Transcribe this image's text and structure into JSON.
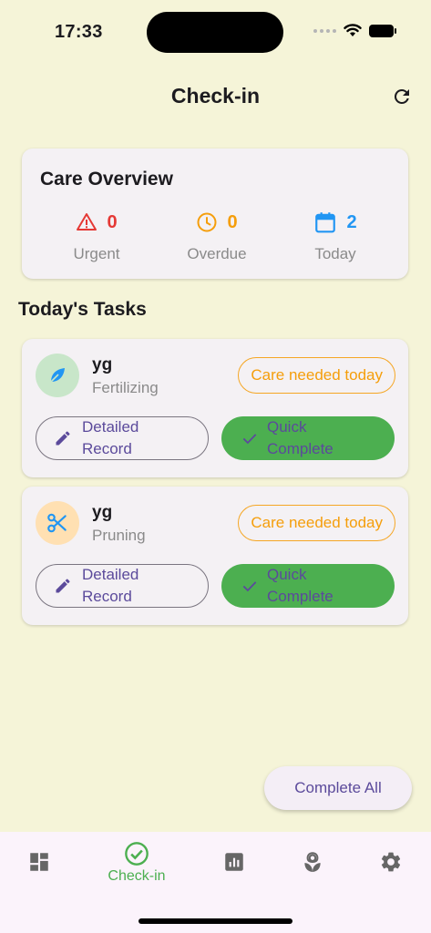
{
  "status_bar": {
    "time": "17:33"
  },
  "app_bar": {
    "title": "Check-in"
  },
  "overview": {
    "title": "Care Overview",
    "stats": [
      {
        "label": "Urgent",
        "value": "0",
        "color": "#e53935",
        "icon": "warning-icon"
      },
      {
        "label": "Overdue",
        "value": "0",
        "color": "#f59e0b",
        "icon": "clock-icon"
      },
      {
        "label": "Today",
        "value": "2",
        "color": "#2196f3",
        "icon": "calendar-icon"
      }
    ]
  },
  "tasks_section": {
    "title": "Today's Tasks"
  },
  "tasks": [
    {
      "name": "yg",
      "type": "Fertilizing",
      "icon": "leaf-icon",
      "avatar_color": "#c8e6c9",
      "badge": "Care needed today",
      "detail_label": "Detailed Record",
      "quick_label": "Quick Complete"
    },
    {
      "name": "yg",
      "type": "Pruning",
      "icon": "scissors-icon",
      "avatar_color": "#ffe0b2",
      "badge": "Care needed today",
      "detail_label": "Detailed Record",
      "quick_label": "Quick Complete"
    }
  ],
  "complete_all": {
    "label": "Complete All"
  },
  "bottom_nav": {
    "items": [
      {
        "icon": "dashboard-icon",
        "label": ""
      },
      {
        "icon": "check-circle-icon",
        "label": "Check-in",
        "active": true
      },
      {
        "icon": "chart-icon",
        "label": ""
      },
      {
        "icon": "plant-icon",
        "label": ""
      },
      {
        "icon": "settings-icon",
        "label": ""
      }
    ]
  },
  "colors": {
    "background": "#f5f4d8",
    "accent_green": "#4caf50",
    "accent_purple": "#5b4a9b",
    "badge_orange": "#f59e0b"
  }
}
